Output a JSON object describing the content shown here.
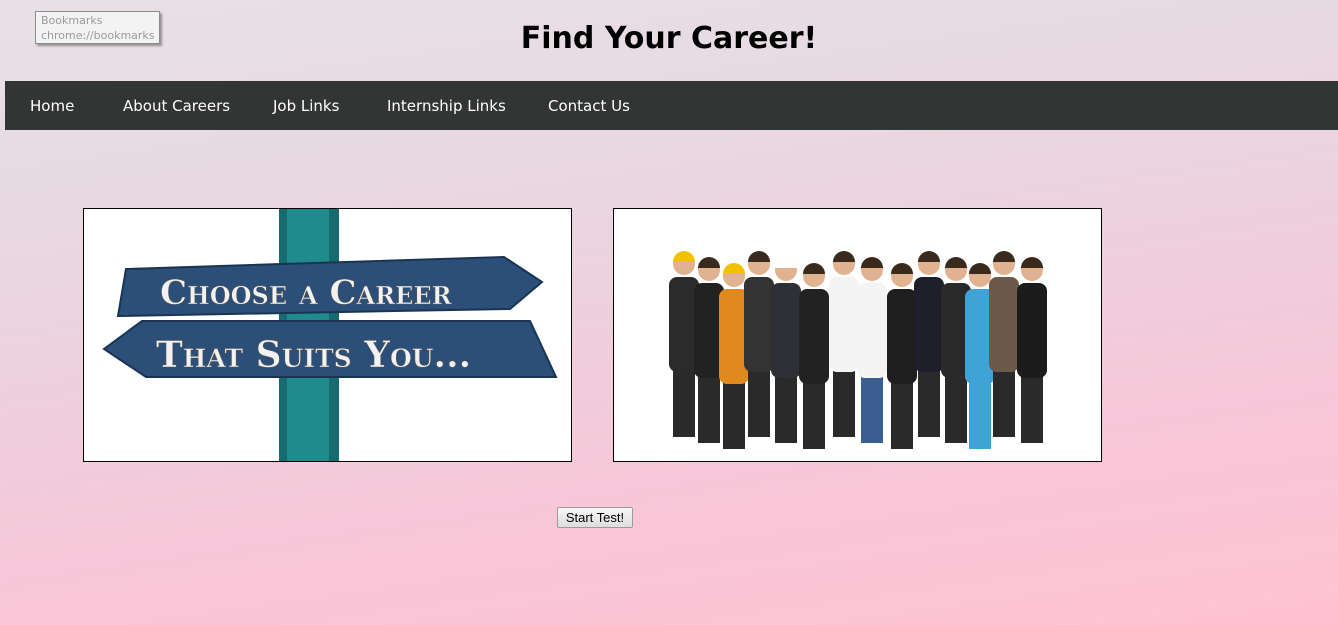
{
  "tooltip": {
    "title": "Bookmarks",
    "url": "chrome://bookmarks"
  },
  "header": {
    "title": "Find Your Career!"
  },
  "nav": {
    "items": [
      {
        "label": "Home"
      },
      {
        "label": "About Careers"
      },
      {
        "label": "Job Links"
      },
      {
        "label": "Internship Links"
      },
      {
        "label": "Contact Us"
      }
    ]
  },
  "images": {
    "signpost": {
      "line1": "Choose a Career",
      "line2": "That Suits You...",
      "sign_color": "#2b4f79",
      "post_color": "#1f8b8e"
    },
    "professionals": {
      "description_icon": "group-of-professionals"
    }
  },
  "actions": {
    "start_label": "Start Test!"
  },
  "colors": {
    "navbar": "#333534",
    "nav_text": "#ffffff",
    "title": "#000000"
  }
}
